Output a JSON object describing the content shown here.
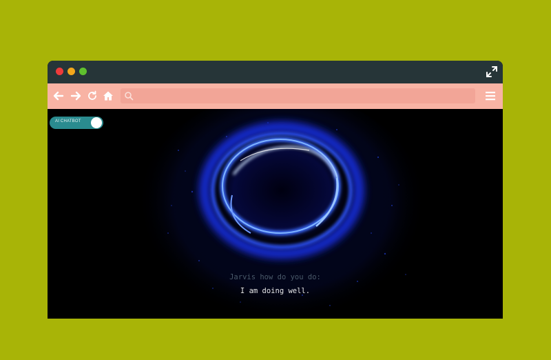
{
  "browser": {
    "window_controls": [
      "close",
      "minimize",
      "maximize"
    ],
    "toolbar_icons": [
      "back-arrow-icon",
      "forward-arrow-icon",
      "reload-icon",
      "home-icon",
      "menu-icon"
    ],
    "address_bar": {
      "value": "",
      "placeholder": ""
    }
  },
  "toggle": {
    "label": "AI CHATBOT",
    "state": "on"
  },
  "conversation": {
    "prompt": "Jarvis how do you do:",
    "response": "I am doing well."
  },
  "colors": {
    "page_background": "#a8b407",
    "titlebar": "#263538",
    "toolbar": "#f8b3a4",
    "address_bar": "#f2a597",
    "toggle": "#2a8b8f",
    "orb_glow": "#1e3cff"
  }
}
